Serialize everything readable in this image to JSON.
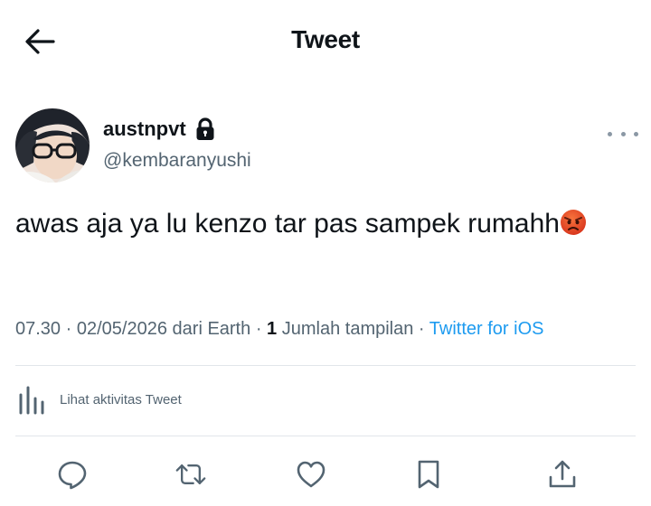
{
  "header": {
    "title": "Tweet",
    "back_icon": "arrow-left-icon"
  },
  "tweet": {
    "author": {
      "display_name": "austnpvt",
      "username": "@kembaranyushi",
      "protected": true
    },
    "text": "awas aja ya lu kenzo tar pas sampek rumahh",
    "emoji": "angry-face-emoji",
    "time": "07.30",
    "date": "02/05/2026",
    "location": "dari Earth",
    "views_count": "1",
    "views_label": "Jumlah tampilan",
    "source": "Twitter for iOS",
    "separator": "·"
  },
  "activity": {
    "label": "Lihat aktivitas Tweet",
    "icon": "analytics-icon"
  },
  "actions": [
    "reply-icon",
    "retweet-icon",
    "like-icon",
    "bookmark-icon",
    "share-icon"
  ],
  "colors": {
    "link": "#1d9bf0",
    "secondary": "#536471",
    "text": "#0f1419"
  }
}
